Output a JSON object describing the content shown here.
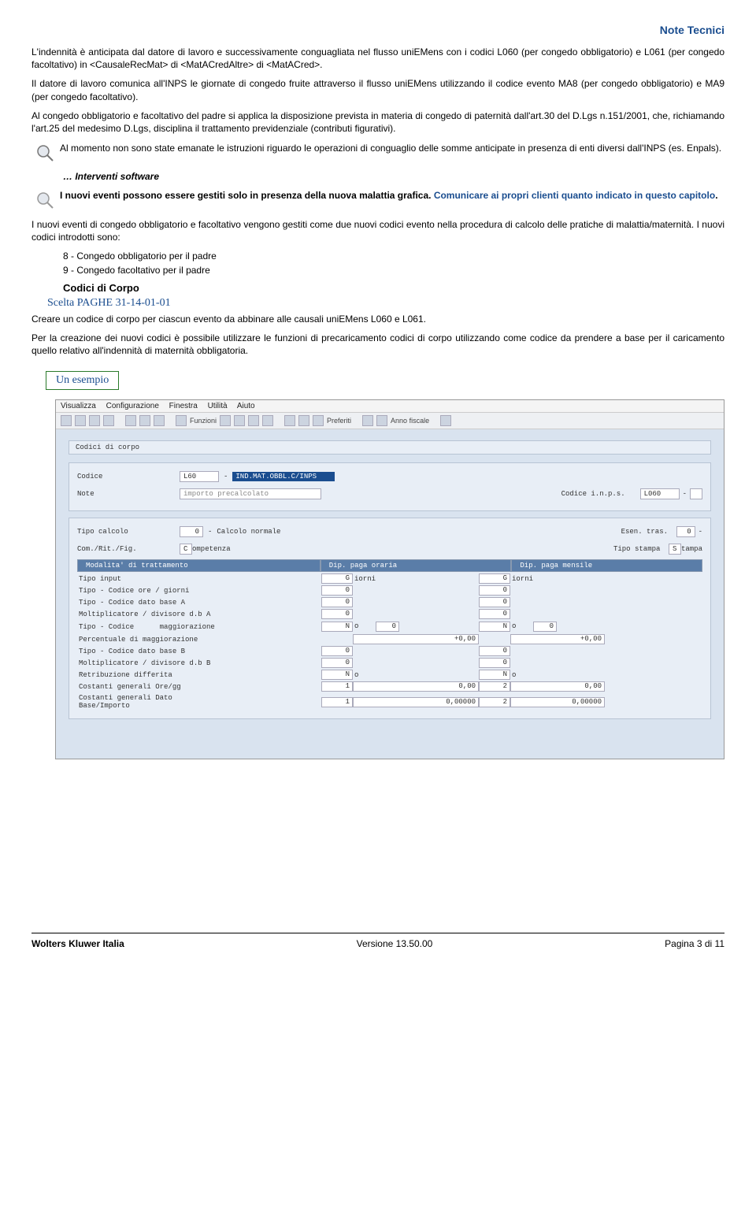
{
  "header": {
    "title": "Note Tecnici"
  },
  "paragraphs": {
    "p1": "L'indennità è anticipata dal datore di lavoro e successivamente conguagliata nel flusso uniEMens con i codici L060 (per congedo obbligatorio) e L061 (per congedo facoltativo) in <CausaleRecMat> di <MatACredAltre> di <MatACred>.",
    "p2": "Il datore di lavoro comunica all'INPS le giornate di congedo fruite attraverso il flusso uniEMens utilizzando il codice evento MA8 (per congedo obbligatorio) e MA9 (per congedo facoltativo).",
    "p3": "Al congedo obbligatorio e facoltativo del padre si applica la disposizione prevista in materia di congedo di paternità dall'art.30 del D.Lgs n.151/2001, che, richiamando l'art.25 del medesimo D.Lgs, disciplina il trattamento previdenziale (contributi figurativi).",
    "note1": "Al momento non sono state emanate le istruzioni riguardo le operazioni di conguaglio delle somme anticipate in presenza di enti diversi dall'INPS (es. Enpals).",
    "interventi": "… Interventi software",
    "note2a": "I nuovi eventi possono essere gestiti solo in presenza della nuova malattia grafica. ",
    "note2b": "Comunicare ai propri clienti quanto indicato in questo capitolo",
    "p4": "I nuovi eventi di congedo obbligatorio e facoltativo vengono gestiti come due nuovi codici evento nella procedura di calcolo delle pratiche di malattia/maternità. I nuovi codici introdotti sono:",
    "li1": "8 - Congedo obbligatorio per il padre",
    "li2": "9 - Congedo facoltativo per il padre",
    "codici": "Codici di Corpo",
    "scelta": "Scelta PAGHE  31-14-01-01",
    "p5": "Creare un codice di corpo per ciascun evento da abbinare alle causali uniEMens L060 e L061.",
    "p6": "Per la creazione dei nuovi codici è possibile utilizzare le funzioni di precaricamento codici di corpo utilizzando come codice da prendere a base per il caricamento quello relativo all'indennità di maternità obbligatoria.",
    "esempio": "Un esempio"
  },
  "app": {
    "menu": {
      "m1": "Visualizza",
      "m2": "Configurazione",
      "m3": "Finestra",
      "m4": "Utilità",
      "m5": "Aiuto"
    },
    "toolbar": {
      "funzioni": "Funzioni",
      "preferiti": "Preferiti",
      "annofiscale": "Anno fiscale"
    },
    "group": "Codici di corpo",
    "form": {
      "codice_lbl": "Codice",
      "codice_val": "L60",
      "codice_dash": "-",
      "codice_desc": "IND.MAT.OBBL.C/INPS",
      "note_lbl": "Note",
      "note_val": "importo precalcolato",
      "codinps_lbl": "Codice i.n.p.s.",
      "codinps_val": "L060",
      "tipocalcolo_lbl": "Tipo calcolo",
      "tipocalcolo_val": "0",
      "tipocalcolo_desc": "Calcolo normale",
      "esen_lbl": "Esen. tras.",
      "esen_val": "0",
      "com_lbl": "Com./Rit./Fig.",
      "com_val": "C",
      "com_desc": "ompetenza",
      "tipostampa_lbl": "Tipo stampa",
      "tipostampa_val": "S",
      "tipostampa_desc": "tampa"
    },
    "tabs": {
      "t1": "Modalita' di trattamento",
      "t2": "Dip. paga oraria",
      "t3": "Dip. paga mensile"
    },
    "grid": {
      "r1": "Tipo input",
      "r1_v1": "G",
      "r1_v1d": "iorni",
      "r1_v2": "G",
      "r1_v2d": "iorni",
      "r2": "Tipo - Codice ore / giorni",
      "r2_v": "0",
      "r2_v2": "0",
      "r3": "Tipo - Codice dato base A",
      "r3_v": "0",
      "r3_v2": "0",
      "r4": "Moltiplicatore / divisore d.b A",
      "r4_v": "0",
      "r4_v2": "0",
      "r5": "Tipo - Codice",
      "r5_sub": "maggiorazione",
      "r5_v": "N",
      "r5_v1": "o",
      "r5_v2": "0",
      "r5_v3": "N",
      "r5_v3d": "o",
      "r5_v4": "0",
      "r6": "Percentuale di maggiorazione",
      "r6_v": "+0,00",
      "r6_v2": "+0,00",
      "r7": "Tipo - Codice dato base B",
      "r7_v": "0",
      "r7_v2": "0",
      "r8": "Moltiplicatore / divisore d.b B",
      "r8_v": "0",
      "r8_v2": "0",
      "r9": "Retribuzione differita",
      "r9_v": "N",
      "r9_vd": "o",
      "r9_v2": "N",
      "r9_v2d": "o",
      "r10": "Costanti generali Ore/gg",
      "r10_v1": "1",
      "r10_v2": "0,00",
      "r10_v3": "2",
      "r10_v4": "0,00",
      "r11": "Costanti generali Dato Base/Importo",
      "r11_v1": "1",
      "r11_v2": "0,00000",
      "r11_v3": "2",
      "r11_v4": "0,00000"
    }
  },
  "footer": {
    "left": "Wolters Kluwer Italia",
    "center": "Versione  13.50.00",
    "right_pre": "Pagina  ",
    "right_num": "3 di 11"
  }
}
